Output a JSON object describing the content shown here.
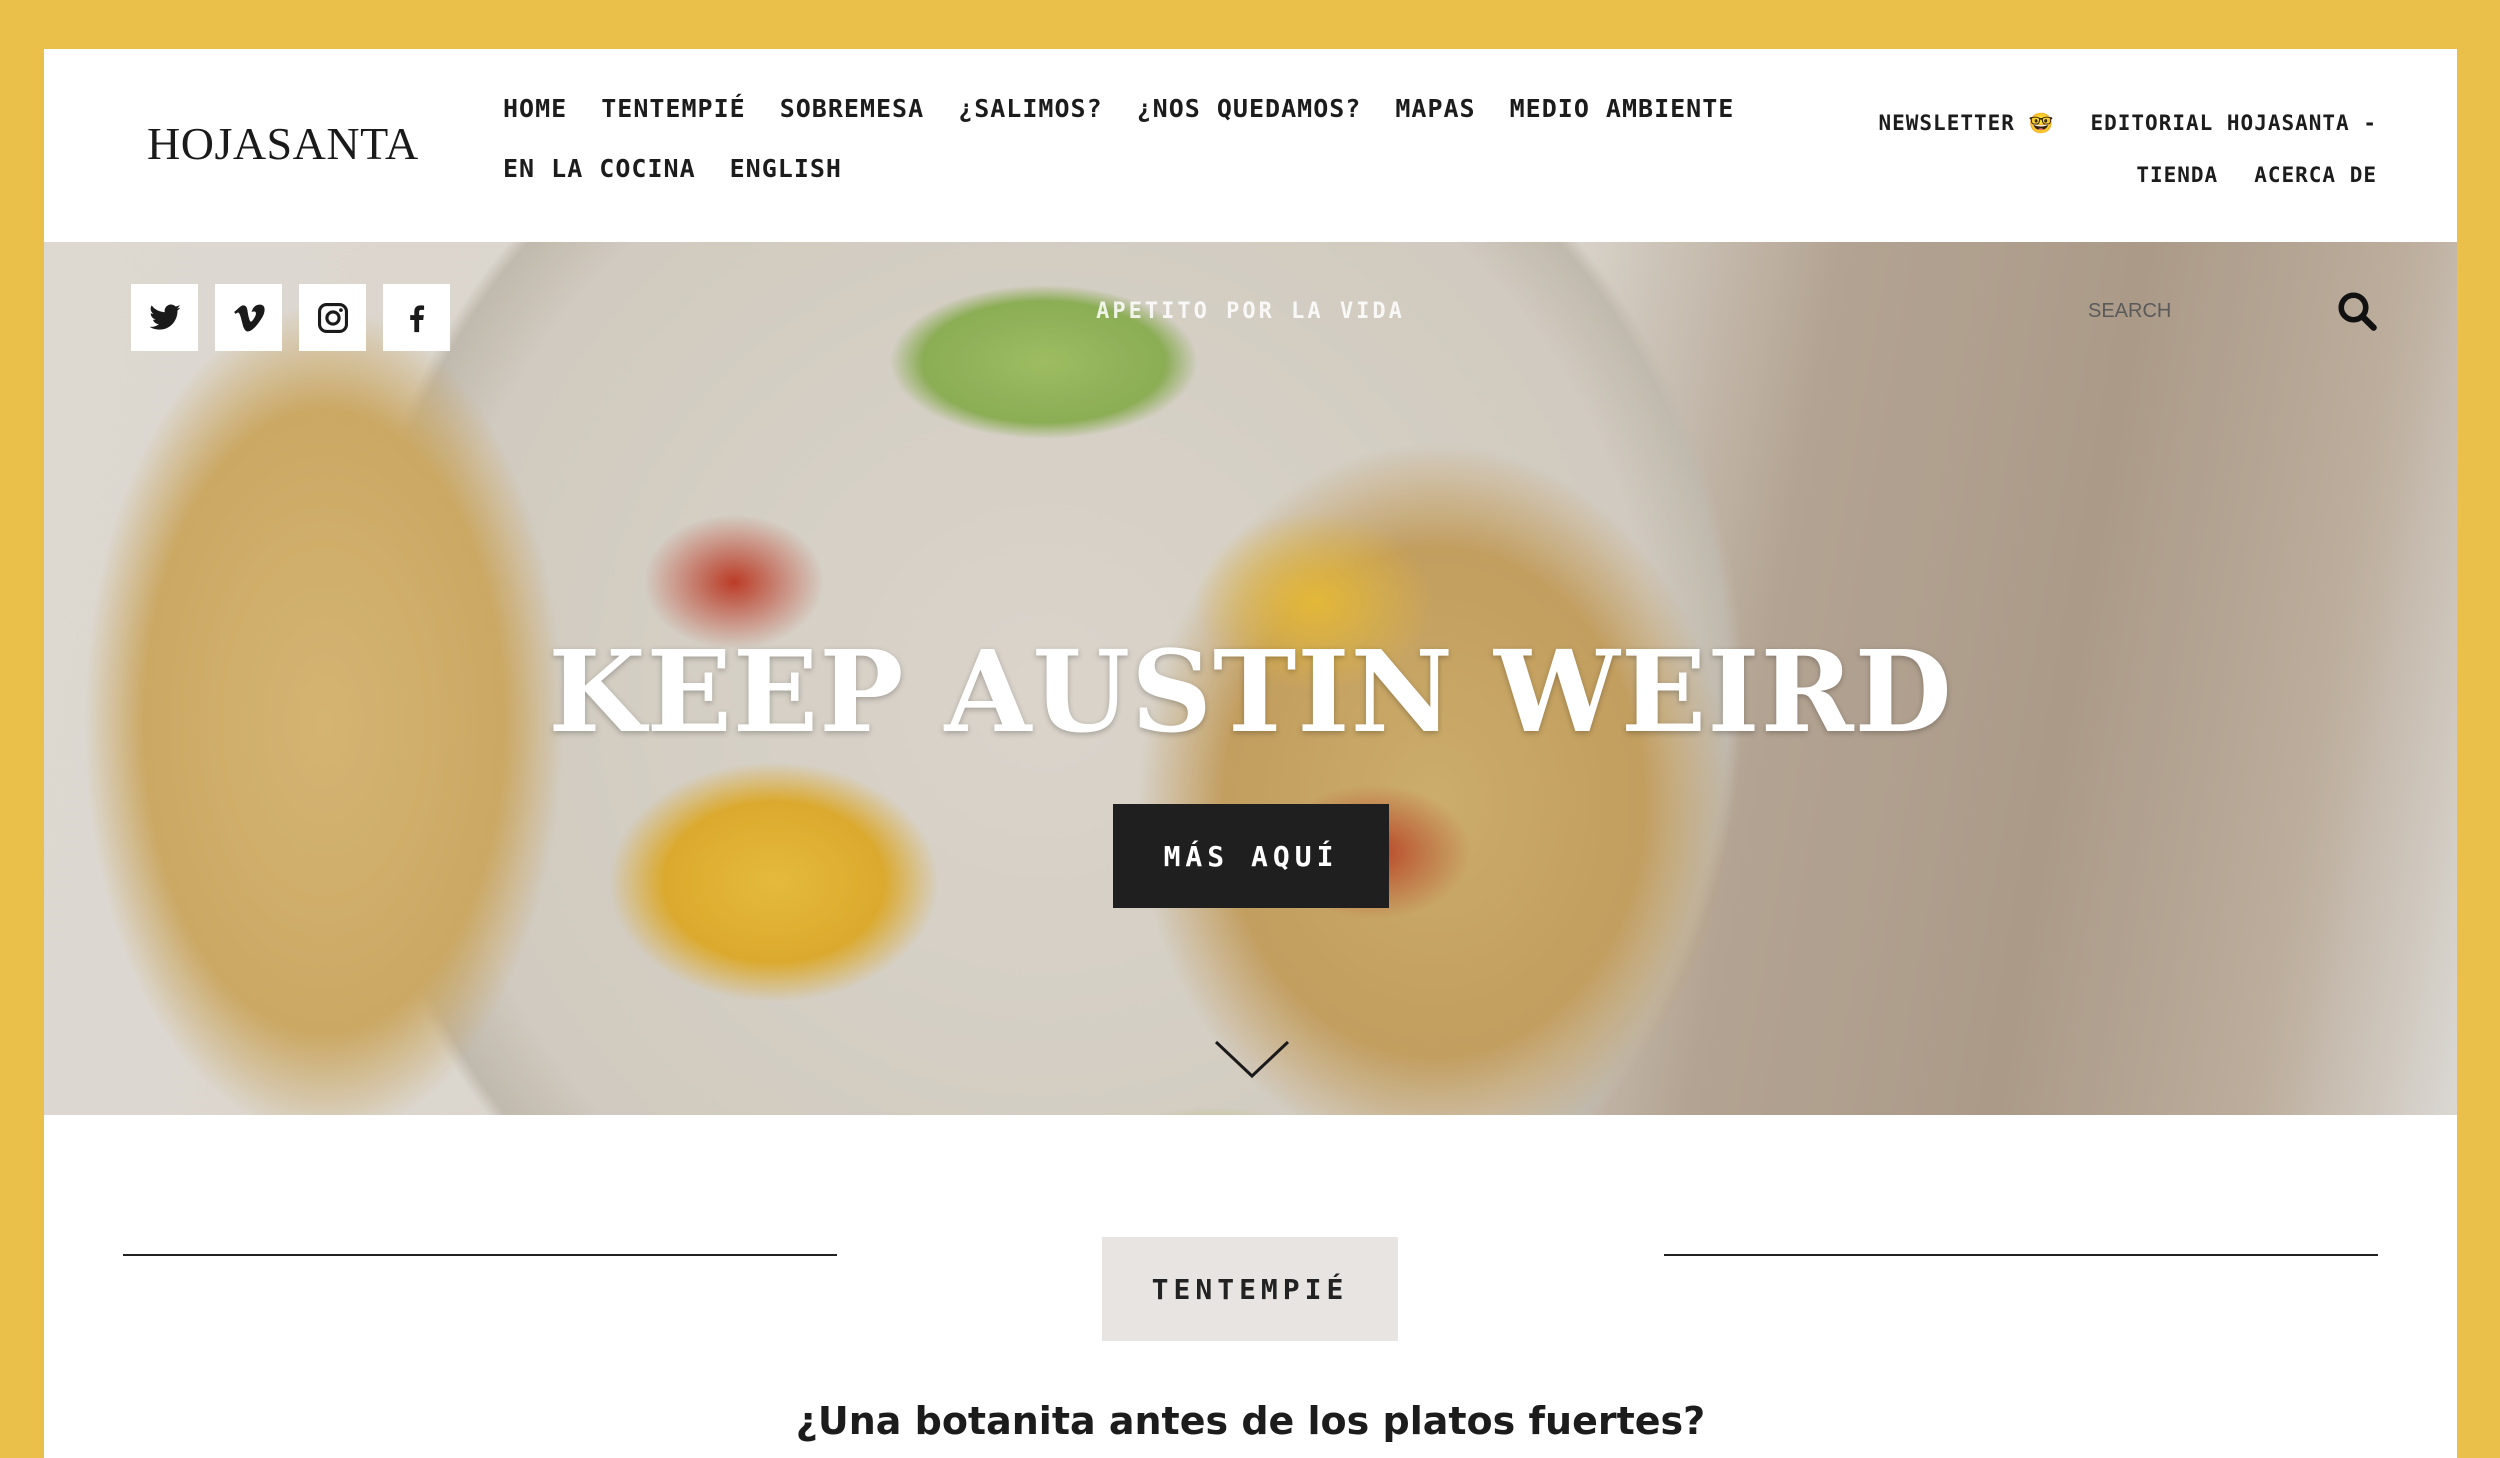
{
  "header": {
    "logo": "Hojasanta",
    "main_nav": [
      "HOME",
      "TENTEMPIÉ",
      "SOBREMESA",
      "¿SALIMOS?",
      "¿NOS QUEDAMOS?",
      "MAPAS",
      "MEDIO AMBIENTE",
      "EN LA COCINA",
      "ENGLISH"
    ],
    "util_nav": {
      "newsletter": "NEWSLETTER",
      "newsletter_emoji": "🤓",
      "editorial": "EDITORIAL HOJASANTA -",
      "tienda": "TIENDA",
      "acerca": "ACERCA DE"
    }
  },
  "hero": {
    "socials": [
      "twitter-icon",
      "vimeo-icon",
      "instagram-icon",
      "facebook-icon"
    ],
    "tagline": "APETITO POR LA VIDA",
    "search_placeholder": "SEARCH",
    "title": "KEEP AUSTIN WEIRD",
    "button_label": "MÁS AQUÍ"
  },
  "section": {
    "badge": "TENTEMPIÉ",
    "subtitle": "¿Una botanita antes de los platos fuertes?"
  },
  "colors": {
    "frame": "#ebc04a",
    "button_bg": "#1f1f1f",
    "badge_bg": "#e7e4e2"
  }
}
